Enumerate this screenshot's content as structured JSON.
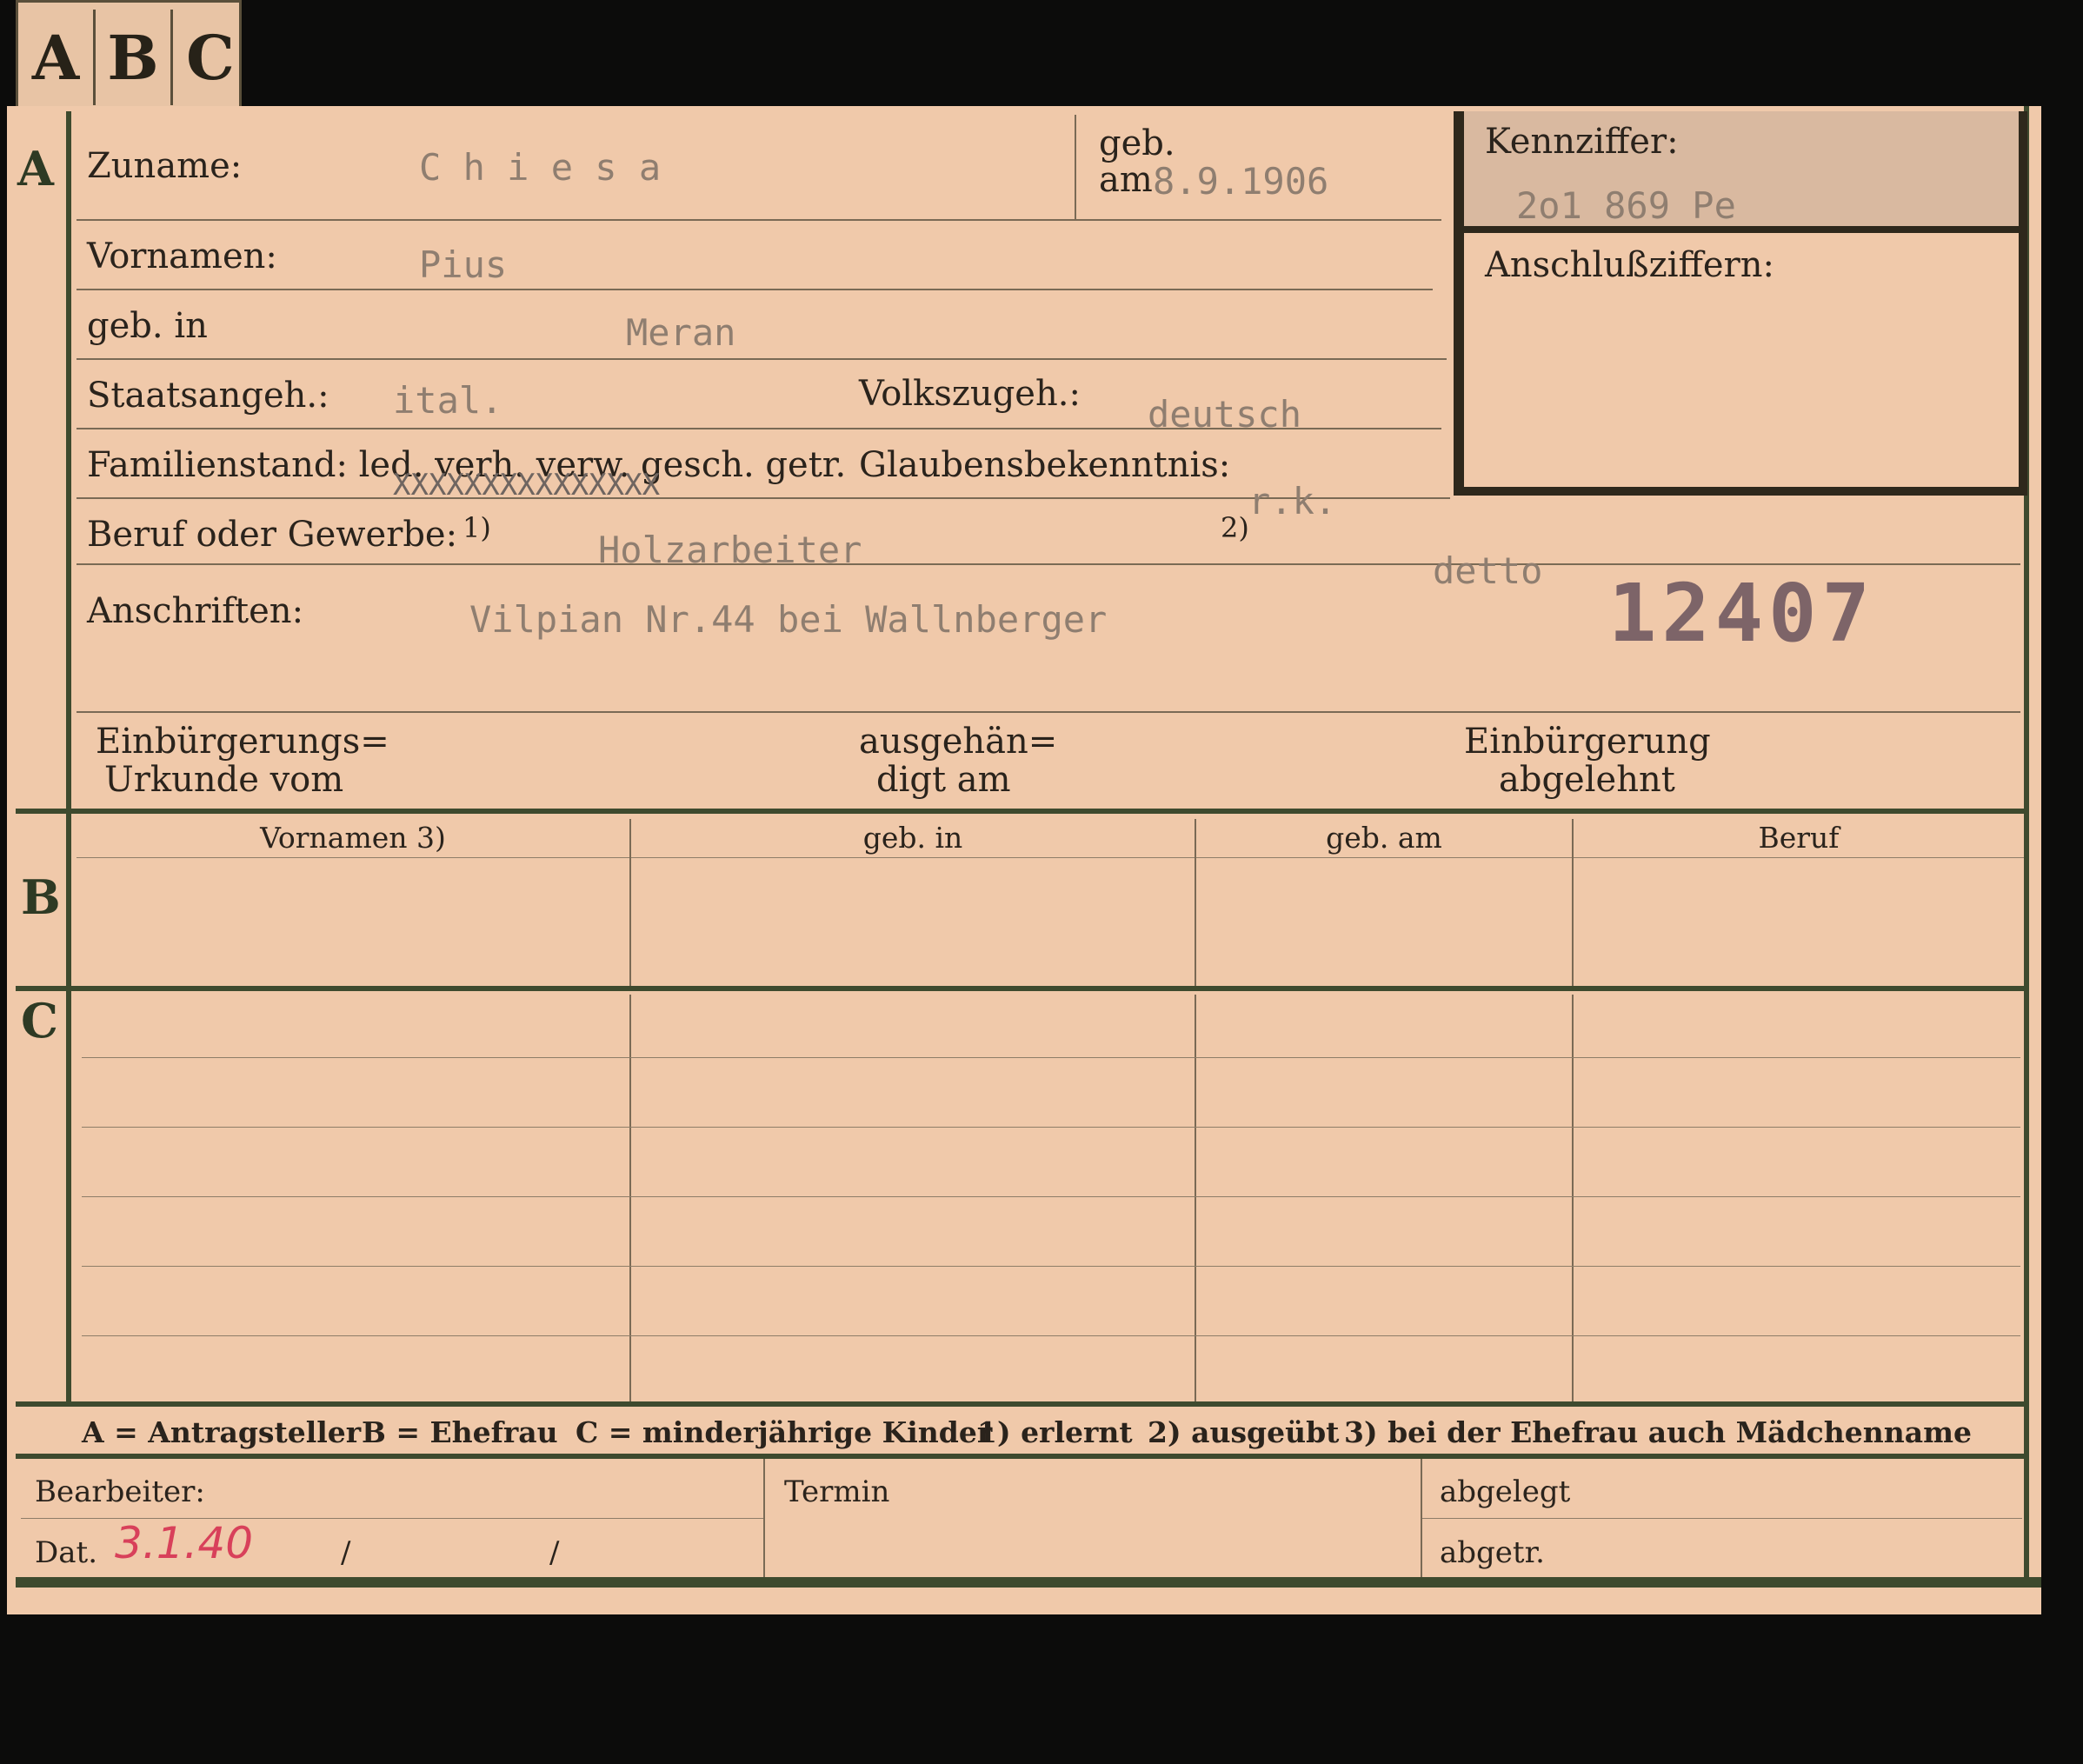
{
  "tabs": [
    "A",
    "B",
    "C"
  ],
  "section_letters": {
    "a": "A",
    "b": "B",
    "c": "C"
  },
  "section_a": {
    "zuname_label": "Zuname:",
    "zuname_value": "C h i e s a",
    "geb_label": "geb.",
    "geb_am_label": "am",
    "geb_am_value": "8.9.1906",
    "vornamen_label": "Vornamen:",
    "vornamen_value": "Pius",
    "geb_in_label": "geb. in",
    "geb_in_value": "Meran",
    "staatsangeh_label": "Staatsangeh.:",
    "staatsangeh_value": "ital.",
    "volkszugeh_label": "Volkszugeh.:",
    "volkszugeh_value": "deutsch",
    "familienstand_label": "Familienstand: led. verh. verw. gesch. getr.",
    "familienstand_strike": "XXXXXXXXXXXXXXX",
    "glaubens_label": "Glaubensbekenntnis:",
    "glaubens_value": "r.k.",
    "beruf_label": "Beruf oder Gewerbe:",
    "beruf_note1": "1)",
    "beruf_value": "Holzarbeiter",
    "beruf_note2": "2)",
    "beruf_value2": "detto",
    "anschriften_label": "Anschriften:",
    "anschriften_value": "Vilpian Nr.44 bei  Wallnberger",
    "stamp_number": "12407",
    "einb_urkunde_line1": "Einbürgerungs=",
    "einb_urkunde_line2": "Urkunde vom",
    "ausgehaendigt_line1": "ausgehän=",
    "ausgehaendigt_line2": "digt am",
    "einb_abgelehnt_line1": "Einbürgerung",
    "einb_abgelehnt_line2": "abgelehnt"
  },
  "kennziffer": {
    "label": "Kennziffer:",
    "value": "2o1 869 Pe",
    "anschluss_label": "Anschlußziffern:"
  },
  "section_b": {
    "columns": [
      "Vornamen 3)",
      "geb. in",
      "geb. am",
      "Beruf"
    ]
  },
  "legend": {
    "a": "A = Antragsteller",
    "b": "B = Ehefrau",
    "c": "C = minderjährige Kinder",
    "n1": "1) erlernt",
    "n2": "2) ausgeübt",
    "n3": "3) bei der Ehefrau auch Mädchenname"
  },
  "footer": {
    "bearbeiter_label": "Bearbeiter:",
    "dat_label": "Dat.",
    "dat_value": "3.1.40",
    "slash1": "/",
    "slash2": "/",
    "termin_label": "Termin",
    "abgelegt_label": "abgelegt",
    "abgetr_label": "abgetr."
  },
  "colors": {
    "card": "#f0c9aa",
    "ink": "#2a231c",
    "typewriter": "#8f7e70",
    "green_band": "#3e4a2e",
    "red_pencil": "#d8405a"
  }
}
